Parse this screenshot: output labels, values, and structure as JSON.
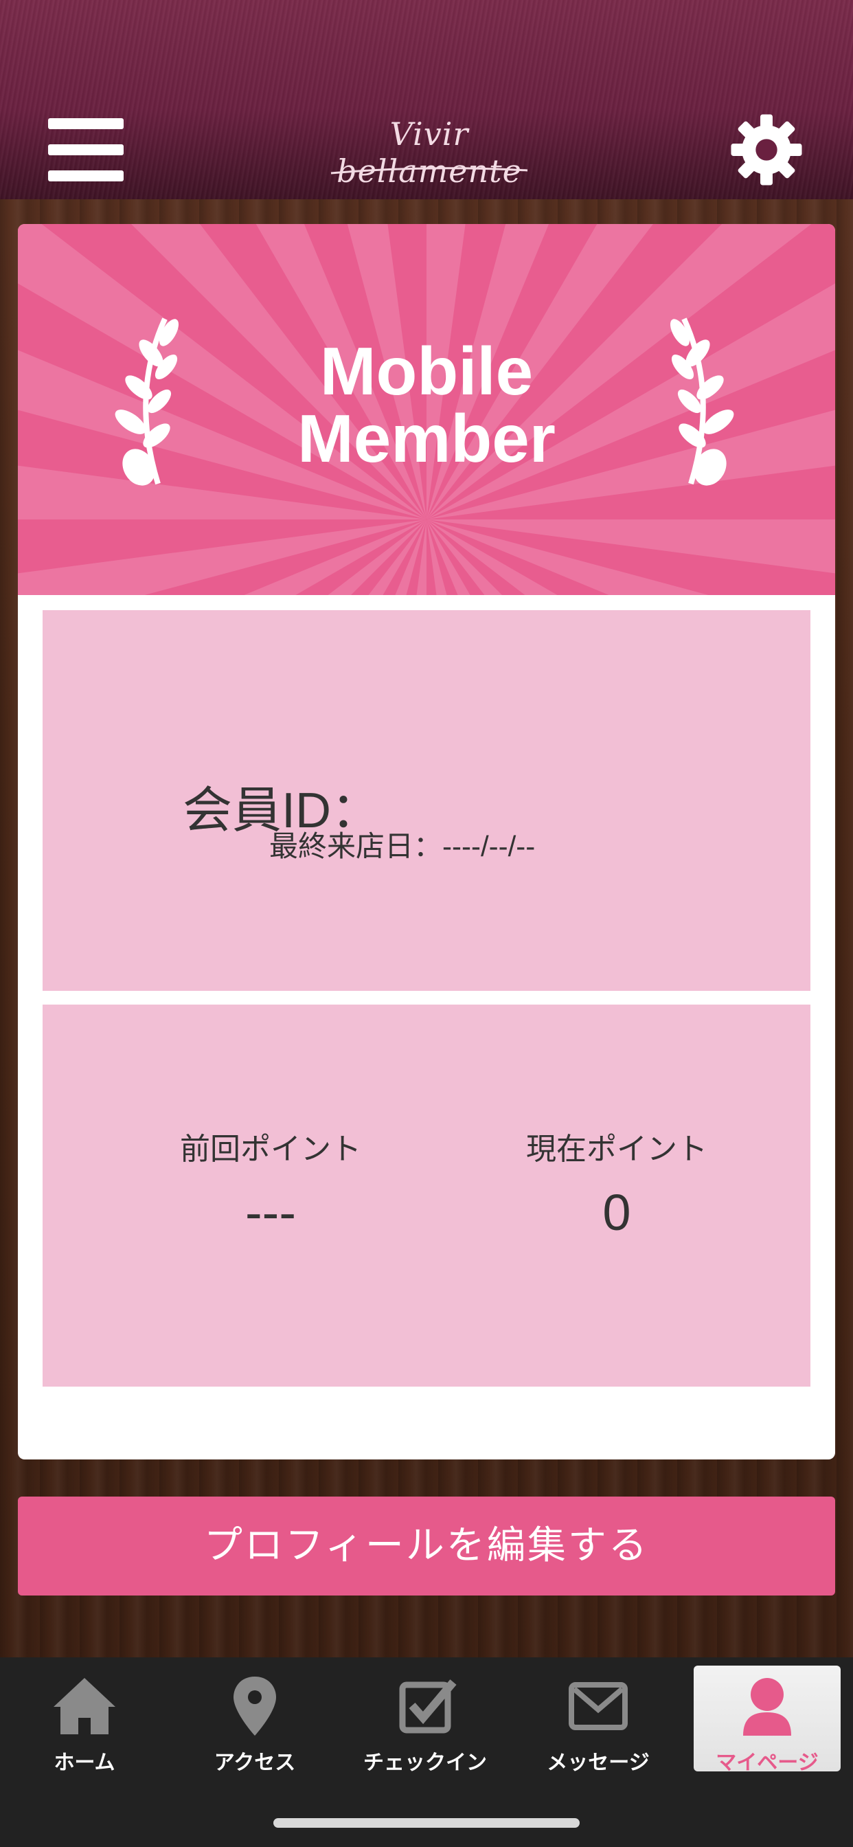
{
  "header": {
    "logo_text": "Vivir bellamente",
    "menu_icon": "hamburger-icon",
    "settings_icon": "gear-icon"
  },
  "card": {
    "banner_title_line1": "Mobile",
    "banner_title_line2": "Member",
    "member_id_label": "会員ID：",
    "last_visit": "最終来店日：----/--/--",
    "previous_points_label": "前回ポイント",
    "previous_points_value": "---",
    "current_points_label": "現在ポイント",
    "current_points_value": "0"
  },
  "edit_button_label": "プロフィールを編集する",
  "tabs": [
    {
      "label": "ホーム",
      "icon": "home-icon"
    },
    {
      "label": "アクセス",
      "icon": "map-pin-icon"
    },
    {
      "label": "チェックイン",
      "icon": "checkbox-icon"
    },
    {
      "label": "メッセージ",
      "icon": "envelope-icon"
    },
    {
      "label": "マイページ",
      "icon": "person-icon",
      "active": true
    }
  ],
  "colors": {
    "accent": "#e65a8b",
    "panel": "#f2bfd5",
    "header": "#6a2040"
  }
}
